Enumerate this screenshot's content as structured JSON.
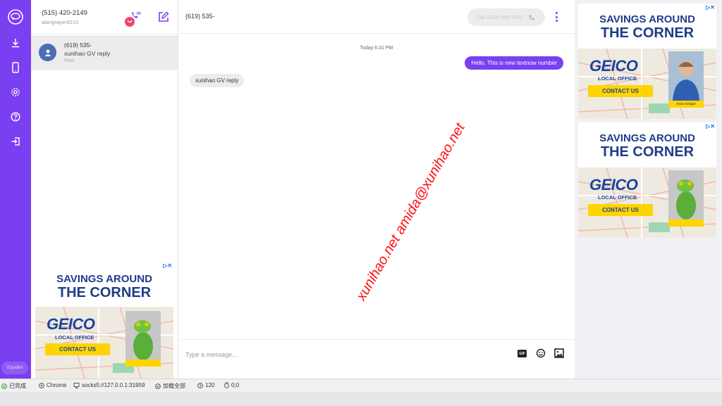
{
  "colors": {
    "accent": "#7b3ff2",
    "ad_navy": "#1f3c88",
    "cta_yellow": "#ffd400",
    "watermark_red": "#ff1010"
  },
  "nav": {
    "items": [
      "logo-icon",
      "download-icon",
      "phone-icon",
      "settings-icon",
      "help-icon",
      "logout-icon"
    ],
    "language_button": "Español"
  },
  "account": {
    "phone_number": "(515) 420-2149",
    "username": "alangrayer9210"
  },
  "conversations": [
    {
      "name": "(619) 535-",
      "preview": "xunihao GV reply",
      "time": "Now"
    }
  ],
  "chat": {
    "contact_number": "(619) 535-",
    "call_button_label": "Call (619) 535-7323",
    "date_separator": "Today 6:31 PM",
    "messages": [
      {
        "direction": "out",
        "text": "Hello. This is new textnow number"
      },
      {
        "direction": "in",
        "text": "xunihao GV reply"
      }
    ],
    "composer_placeholder": "Type a message...",
    "gif_label": "GIF"
  },
  "watermark": "xunihao.net amida@xunihao.net",
  "ads": [
    {
      "headline1": "SAVINGS AROUND",
      "headline2": "THE CORNER",
      "brand": "GEICO",
      "office": "LOCAL OFFICE",
      "cta": "CONTACT US",
      "caption": ""
    },
    {
      "headline1": "SAVINGS AROUND",
      "headline2": "THE CORNER",
      "brand": "GEICO",
      "office": "LOCAL OFFICE",
      "cta": "CONTACT US",
      "caption": "Kevin Krieger"
    },
    {
      "headline1": "SAVINGS AROUND",
      "headline2": "THE CORNER",
      "brand": "GEICO",
      "office": "LOCAL OFFICE",
      "cta": "CONTACT US",
      "caption": ""
    }
  ],
  "status_bar": {
    "state": "已完成",
    "browser": "Chrome",
    "proxy": "socks5://127.0.0.1:31959",
    "loaded": "加载全部",
    "timer": "120",
    "coords": "0;0"
  }
}
